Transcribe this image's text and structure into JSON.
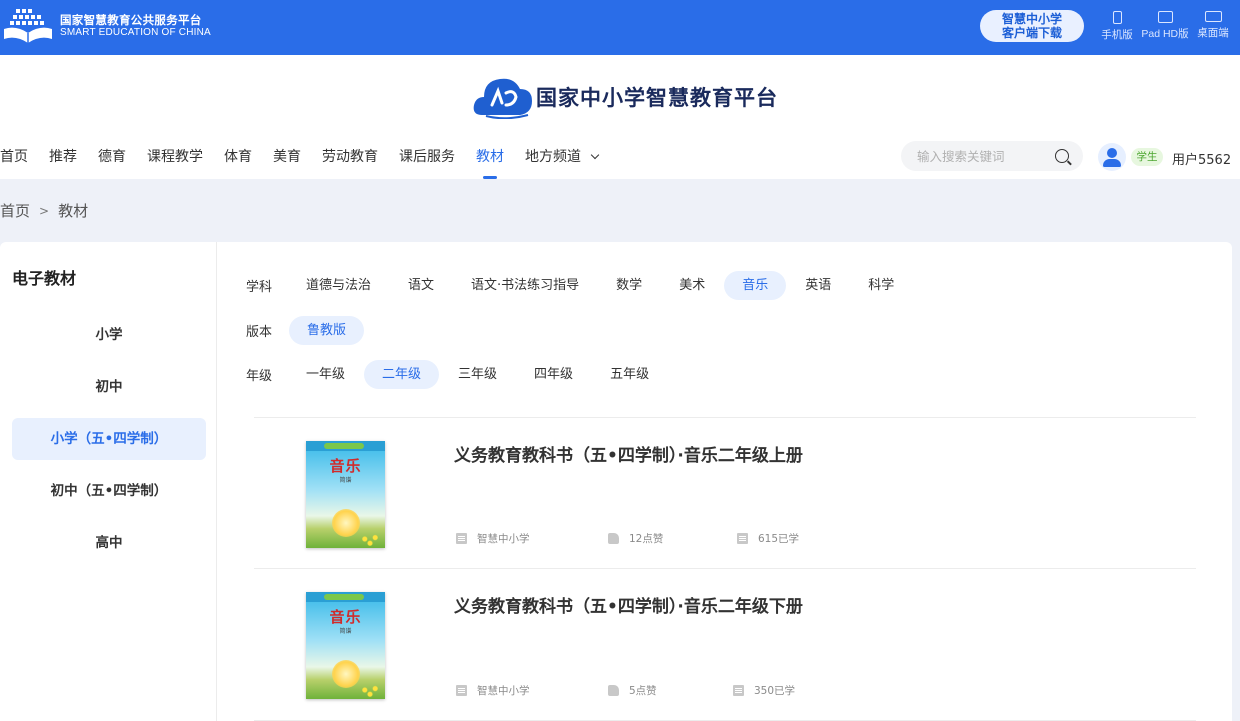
{
  "topbar": {
    "logo_cn": "国家智慧教育公共服务平台",
    "logo_en": "SMART EDUCATION OF CHINA",
    "download_line1": "智慧中小学",
    "download_line2": "客户端下载",
    "devices": [
      {
        "label": "手机版",
        "icon": "phone-icon"
      },
      {
        "label": "Pad HD版",
        "icon": "tablet-icon"
      },
      {
        "label": "桌面端",
        "icon": "laptop-icon"
      }
    ]
  },
  "header": {
    "brand_title": "国家中小学智慧教育平台",
    "nav": [
      {
        "label": "首页"
      },
      {
        "label": "推荐"
      },
      {
        "label": "德育"
      },
      {
        "label": "课程教学"
      },
      {
        "label": "体育"
      },
      {
        "label": "美育"
      },
      {
        "label": "劳动教育"
      },
      {
        "label": "课后服务"
      },
      {
        "label": "教材",
        "active": true
      },
      {
        "label": "地方频道",
        "dropdown": true
      }
    ],
    "search_placeholder": "输入搜索关键词",
    "role_badge": "学生",
    "username": "用户5562"
  },
  "breadcrumb": {
    "home": "首页",
    "separator": ">",
    "current": "教材"
  },
  "sidebar": {
    "title": "电子教材",
    "items": [
      {
        "label": "小学"
      },
      {
        "label": "初中"
      },
      {
        "label": "小学（五•四学制）",
        "active": true
      },
      {
        "label": "初中（五•四学制）"
      },
      {
        "label": "高中"
      }
    ]
  },
  "filters": {
    "subject_label": "学科",
    "subjects": [
      "道德与法治",
      "语文",
      "语文·书法练习指导",
      "数学",
      "美术",
      "音乐",
      "英语",
      "科学"
    ],
    "subject_selected": "音乐",
    "edition_label": "版本",
    "editions": [
      "鲁教版"
    ],
    "edition_selected": "鲁教版",
    "grade_label": "年级",
    "grades": [
      "一年级",
      "二年级",
      "三年级",
      "四年级",
      "五年级"
    ],
    "grade_selected": "二年级"
  },
  "books": [
    {
      "title": "义务教育教科书（五•四学制）·音乐二年级上册",
      "cover_title": "音乐",
      "cover_sub": "简谱",
      "publisher": "智慧中小学",
      "likes": "12点赞",
      "learned": "615已学"
    },
    {
      "title": "义务教育教科书（五•四学制）·音乐二年级下册",
      "cover_title": "音乐",
      "cover_sub": "简谱",
      "publisher": "智慧中小学",
      "likes": "5点赞",
      "learned": "350已学"
    }
  ],
  "colors": {
    "brand_blue": "#2a6de8",
    "active_bg": "#e8f0fe",
    "page_bg": "#eef1f8",
    "student_green": "#4ca630"
  }
}
